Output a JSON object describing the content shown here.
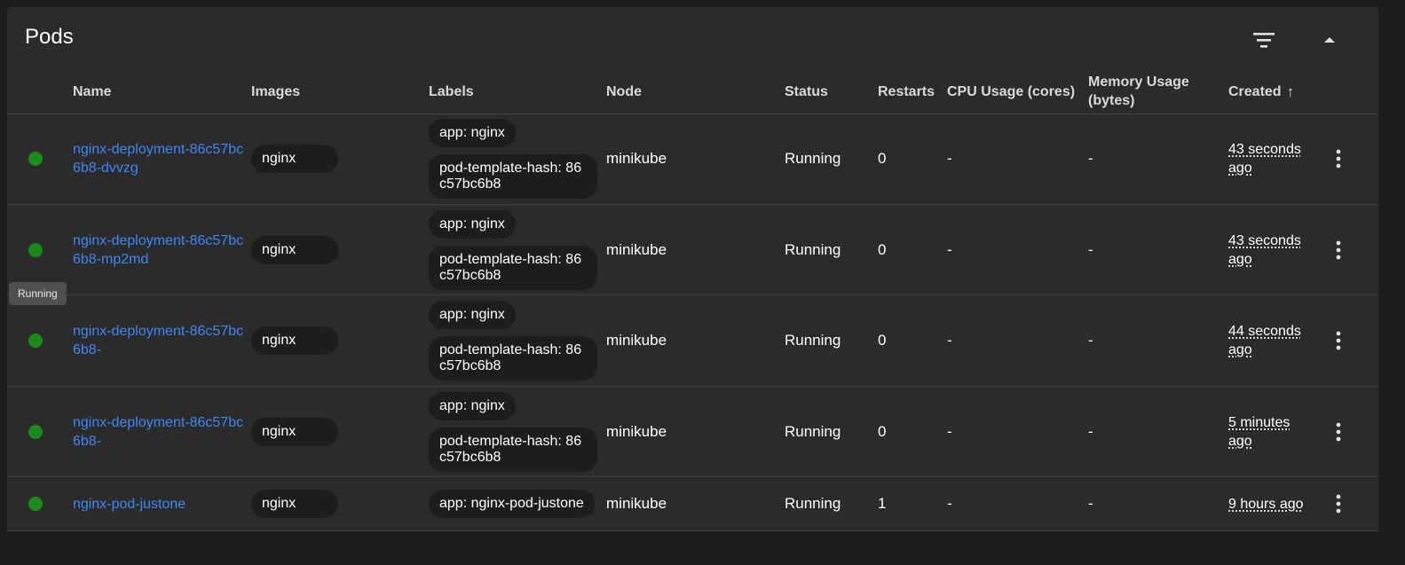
{
  "panel": {
    "title": "Pods"
  },
  "columns": {
    "name": "Name",
    "images": "Images",
    "labels": "Labels",
    "node": "Node",
    "status": "Status",
    "restarts": "Restarts",
    "cpu": "CPU Usage (cores)",
    "memory": "Memory Usage (bytes)",
    "created": "Created",
    "sort_icon": "arrow-up-icon"
  },
  "rows": [
    {
      "name": "nginx-deployment-86c57bc6b8-dvvzg",
      "image": "nginx",
      "labels": [
        "app: nginx",
        "pod-template-hash: 86c57bc6b8"
      ],
      "node": "minikube",
      "status": "Running",
      "restarts": "0",
      "cpu": "-",
      "memory": "-",
      "created": "43 seconds ago"
    },
    {
      "name": "nginx-deployment-86c57bc6b8-mp2md",
      "image": "nginx",
      "labels": [
        "app: nginx",
        "pod-template-hash: 86c57bc6b8"
      ],
      "node": "minikube",
      "status": "Running",
      "restarts": "0",
      "cpu": "-",
      "memory": "-",
      "created": "43 seconds ago"
    },
    {
      "name": "nginx-deployment-86c57bc6b8-",
      "image": "nginx",
      "labels": [
        "app: nginx",
        "pod-template-hash: 86c57bc6b8"
      ],
      "node": "minikube",
      "status": "Running",
      "restarts": "0",
      "cpu": "-",
      "memory": "-",
      "created": "44 seconds ago"
    },
    {
      "name": "nginx-deployment-86c57bc6b8-",
      "image": "nginx",
      "labels": [
        "app: nginx",
        "pod-template-hash: 86c57bc6b8"
      ],
      "node": "minikube",
      "status": "Running",
      "restarts": "0",
      "cpu": "-",
      "memory": "-",
      "created": "5 minutes ago"
    },
    {
      "name": "nginx-pod-justone",
      "image": "nginx",
      "labels": [
        "app: nginx-pod-justone"
      ],
      "node": "minikube",
      "status": "Running",
      "restarts": "1",
      "cpu": "-",
      "memory": "-",
      "created": "9 hours ago"
    }
  ],
  "tooltip": {
    "text": "Running"
  },
  "colors": {
    "status_running": "#1a8a1a",
    "link": "#3f86f4",
    "panel_bg": "#2b2b2b",
    "page_bg": "#1c1c1c",
    "chip_bg": "#1d1d1d"
  },
  "icons": {
    "filter": "filter-icon",
    "collapse": "chevron-up-icon",
    "row_menu": "more-vert-icon",
    "status": "status-dot-icon"
  }
}
